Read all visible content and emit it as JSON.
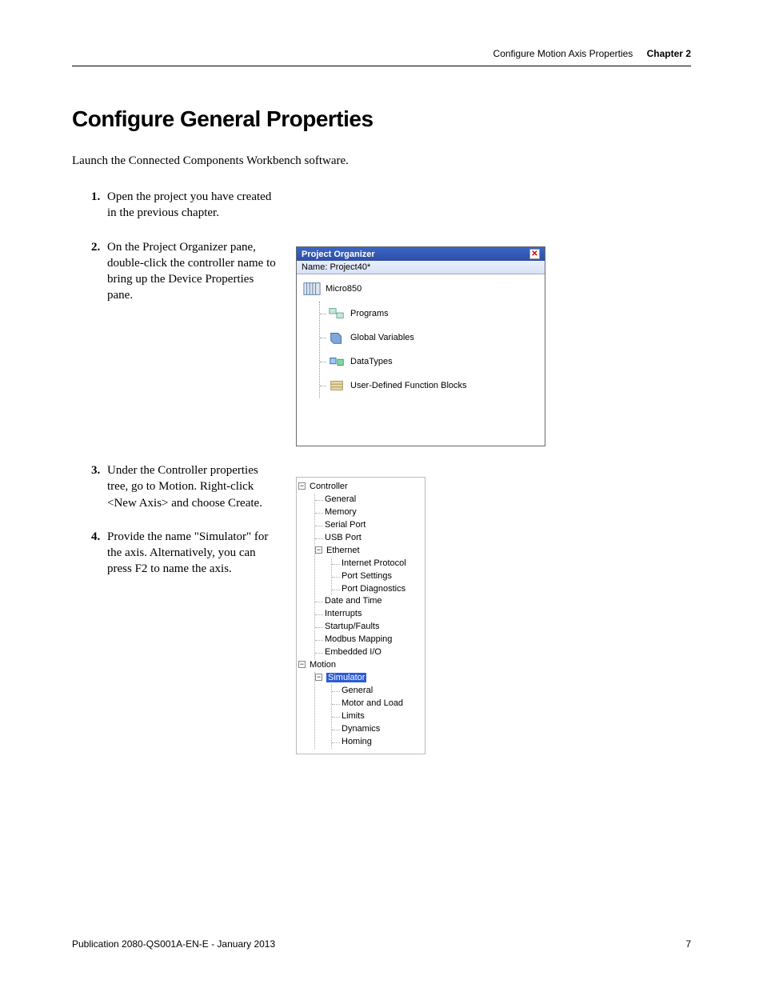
{
  "header": {
    "section": "Configure Motion Axis Properties",
    "chapter": "Chapter 2"
  },
  "title": "Configure General Properties",
  "intro": "Launch the Connected Components Workbench software.",
  "steps": [
    "Open the project you have created in the previous chapter.",
    "On the Project Organizer pane, double-click the controller name to bring up the Device Properties pane.",
    "Under the Controller properties tree, go to Motion. Right-click <New Axis> and choose Create.",
    "Provide the name \"Simulator\" for the axis. Alternatively, you can press F2 to name the axis."
  ],
  "project_organizer": {
    "title": "Project Organizer",
    "name_label": "Name:",
    "name_value": "Project40*",
    "root": "Micro850",
    "items": [
      "Programs",
      "Global Variables",
      "DataTypes",
      "User-Defined Function Blocks"
    ]
  },
  "prop_tree": {
    "controller": "Controller",
    "controller_children": [
      "General",
      "Memory",
      "Serial Port",
      "USB Port"
    ],
    "ethernet": "Ethernet",
    "ethernet_children": [
      "Internet Protocol",
      "Port Settings",
      "Port Diagnostics"
    ],
    "controller_children2": [
      "Date and Time",
      "Interrupts",
      "Startup/Faults",
      "Modbus Mapping",
      "Embedded I/O"
    ],
    "motion": "Motion",
    "simulator": "Simulator",
    "simulator_children": [
      "General",
      "Motor and Load",
      "Limits",
      "Dynamics",
      "Homing"
    ]
  },
  "footer": {
    "pub": "Publication 2080-QS001A-EN-E - January 2013",
    "page": "7"
  }
}
